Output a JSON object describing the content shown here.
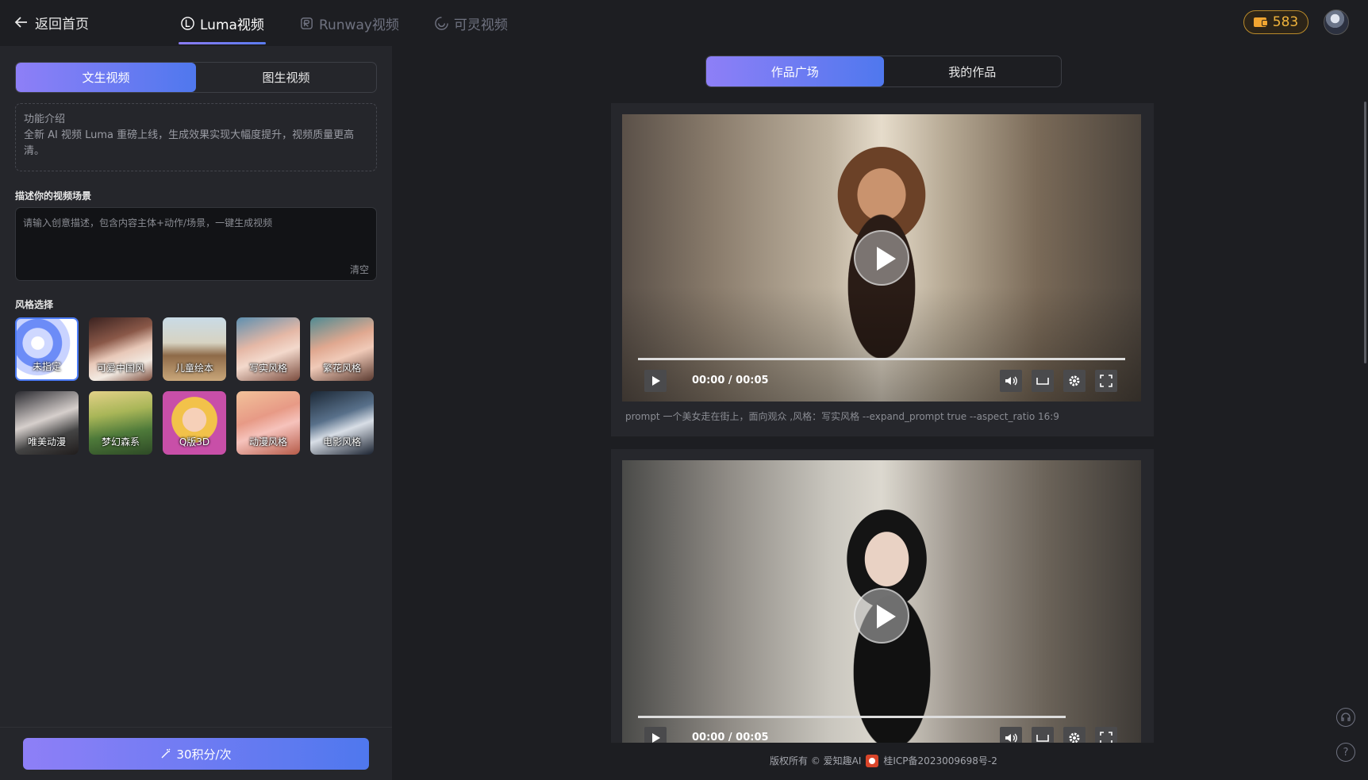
{
  "nav": {
    "back_label": "返回首页",
    "tabs": [
      {
        "label": "Luma视频",
        "active": true,
        "icon": "luma-icon"
      },
      {
        "label": "Runway视频",
        "active": false,
        "icon": "runway-icon"
      },
      {
        "label": "可灵视频",
        "active": false,
        "icon": "kling-icon"
      }
    ],
    "credits": "583",
    "accent_color": "#f1b43c"
  },
  "left": {
    "mode_tabs": [
      {
        "label": "文生视频",
        "active": true
      },
      {
        "label": "图生视频",
        "active": false
      }
    ],
    "intro_title": "功能介绍",
    "intro_text": "全新 AI 视频 Luma 重磅上线，生成效果实现大幅度提升，视频质量更高清。",
    "prompt_label": "描述你的视频场景",
    "prompt_placeholder": "请输入创意描述，包含内容主体+动作/场景，一键生成视频",
    "clear_label": "清空",
    "style_label": "风格选择",
    "styles": [
      {
        "label": "未指定",
        "selected": true
      },
      {
        "label": "可爱中国风",
        "selected": false
      },
      {
        "label": "儿童绘本",
        "selected": false
      },
      {
        "label": "写实风格",
        "selected": false
      },
      {
        "label": "繁花风格",
        "selected": false
      },
      {
        "label": "唯美动漫",
        "selected": false
      },
      {
        "label": "梦幻森系",
        "selected": false
      },
      {
        "label": "Q版3D",
        "selected": false
      },
      {
        "label": "动漫风格",
        "selected": false
      },
      {
        "label": "电影风格",
        "selected": false
      }
    ],
    "generate_label": "30积分/次"
  },
  "gallery": {
    "switch": [
      {
        "label": "作品广场",
        "active": true
      },
      {
        "label": "我的作品",
        "active": false
      }
    ],
    "videos": [
      {
        "time": "00:00 / 00:05",
        "prompt": "prompt 一个美女走在街上，面向观众 ,风格：写实风格 --expand_prompt true --aspect_ratio 16:9",
        "progress": 0.0
      },
      {
        "time": "00:00 / 00:05",
        "prompt": "",
        "progress": 0.0
      }
    ]
  },
  "footer": {
    "copyright": "版权所有 © 爱知趣AI",
    "icp": "桂ICP备2023009698号-2"
  }
}
